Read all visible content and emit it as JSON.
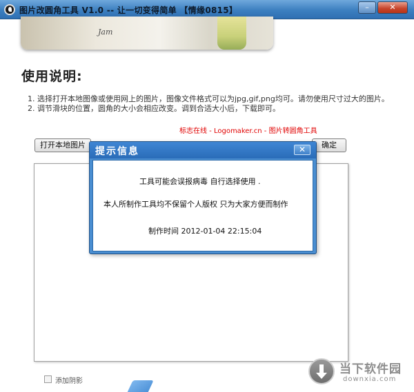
{
  "window": {
    "title": "图片改圆角工具 V1.0  -- 让一切变得简单 【情缘0815】",
    "minimize_symbol": "–",
    "close_symbol": "✕"
  },
  "banner": {
    "signature": "Jam"
  },
  "instructions": {
    "heading": "使用说明:",
    "items": [
      "1.  选择打开本地图像或使用网上的图片，图像文件格式可以为jpg,gif,png均可。请勿使用尺寸过大的图片。",
      "2.  调节滑块的位置，圆角的大小会相应改变。调到合适大小后，下载即可。"
    ]
  },
  "link_text": "标志在线 - Logomaker.cn - 图片转圆角工具",
  "buttons": {
    "open_local": "打开本地图片",
    "confirm": "确定"
  },
  "options": {
    "add_shadow_label": "添加阴影"
  },
  "dialog": {
    "title": "提示信息",
    "close_symbol": "✕",
    "lines": [
      "工具可能会误报病毒 自行选择使用 .",
      "本人所制作工具均不保留个人版权 只为大家方便而制作",
      "制作时间 2012-01-04 22:15:04"
    ]
  },
  "watermark": {
    "cn": "当下软件园",
    "en": "downxia.com"
  },
  "colors": {
    "titlebar": "#3c7fc0",
    "dialog_frame": "#4a8ed1",
    "link_red": "#e00000"
  }
}
